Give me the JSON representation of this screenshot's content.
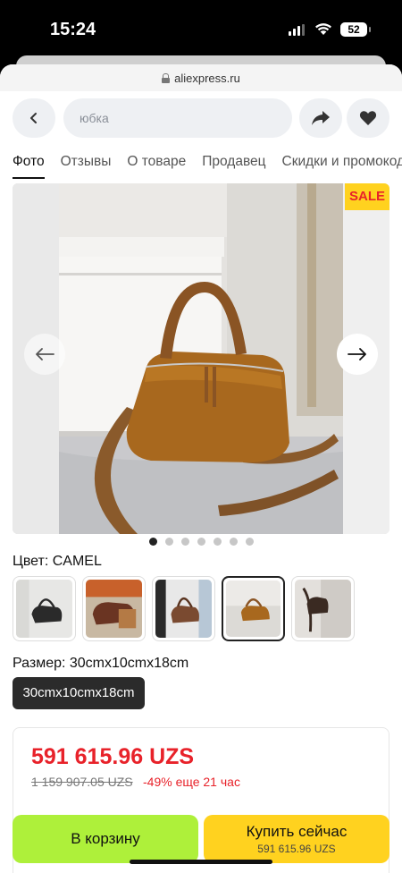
{
  "status_bar": {
    "time": "15:24",
    "battery": "52"
  },
  "browser": {
    "url": "aliexpress.ru"
  },
  "search": {
    "value": "юбка"
  },
  "tabs": [
    {
      "label": "Фото",
      "active": true
    },
    {
      "label": "Отзывы",
      "active": false
    },
    {
      "label": "О товаре",
      "active": false
    },
    {
      "label": "Продавец",
      "active": false
    },
    {
      "label": "Скидки и промокоды",
      "active": false
    }
  ],
  "gallery": {
    "badge": "SALE",
    "image_count": 7,
    "current_index": 0
  },
  "product": {
    "color_label": "Цвет: CAMEL",
    "size_label": "Размер: 30cmx10cmx18cm",
    "size_option": "30cmx10cmx18cm",
    "selected_color_index": 3
  },
  "price": {
    "current": "591 615.96 UZS",
    "old": "1 159 907.05 UZS",
    "discount": "-49% еще 21 час"
  },
  "actions": {
    "cart_label": "В корзину",
    "buy_label": "Купить сейчас",
    "buy_price": "591 615.96 UZS"
  }
}
